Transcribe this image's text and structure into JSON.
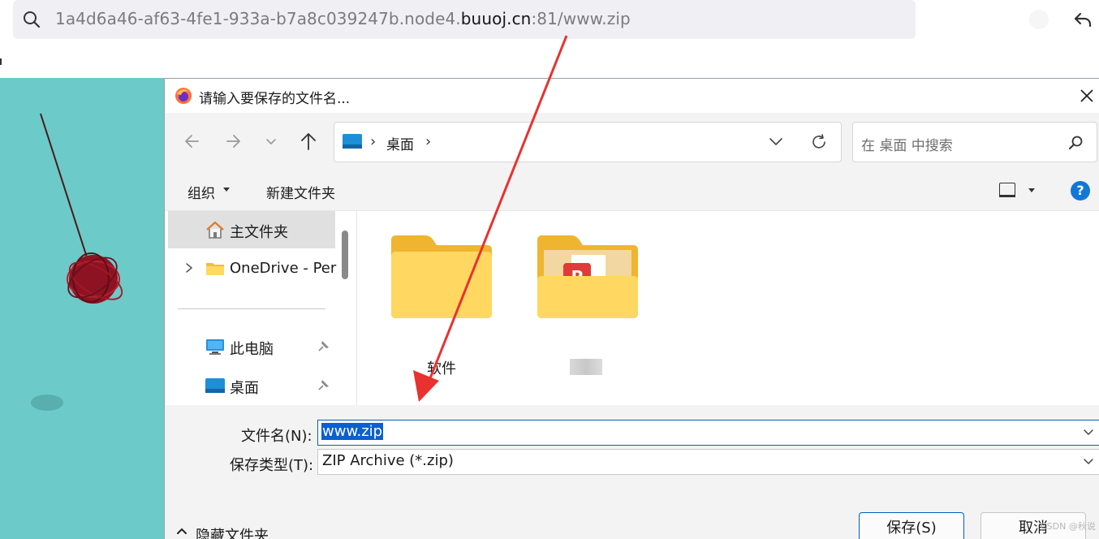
{
  "browser": {
    "url_prefix": "1a4d6a46-af63-4fe1-933a-b7a8c039247b.node4.",
    "url_host": "buuoj.cn",
    "url_suffix": ":81/www.zip"
  },
  "dialog": {
    "title": "请输入要保存的文件名...",
    "breadcrumb": {
      "location": "桌面"
    },
    "search_placeholder": "在 桌面 中搜索",
    "toolbar": {
      "organize": "组织",
      "new_folder": "新建文件夹",
      "help": "?"
    },
    "nav": {
      "items": [
        {
          "label": "主文件夹",
          "icon": "home-icon"
        },
        {
          "label": "OneDrive - Per",
          "icon": "folder-icon"
        },
        {
          "label": "此电脑",
          "icon": "computer-icon"
        },
        {
          "label": "桌面",
          "icon": "desktop-icon"
        }
      ]
    },
    "files": [
      {
        "name": "软件",
        "icon": "folder-icon"
      },
      {
        "name": "",
        "icon": "folder-with-document-icon"
      }
    ],
    "form": {
      "filename_label": "文件名(N):",
      "filename_value": "www.zip",
      "filetype_label": "保存类型(T):",
      "filetype_value": "ZIP Archive (*.zip)"
    },
    "footer": {
      "hide_folders": "隐藏文件夹",
      "save": "保存(S)",
      "cancel": "取消"
    }
  },
  "watermark": "CSDN @秋说",
  "colors": {
    "accent": "#005fb8",
    "annotation_arrow": "#e8322f",
    "background_scene": "#6ccac9"
  }
}
